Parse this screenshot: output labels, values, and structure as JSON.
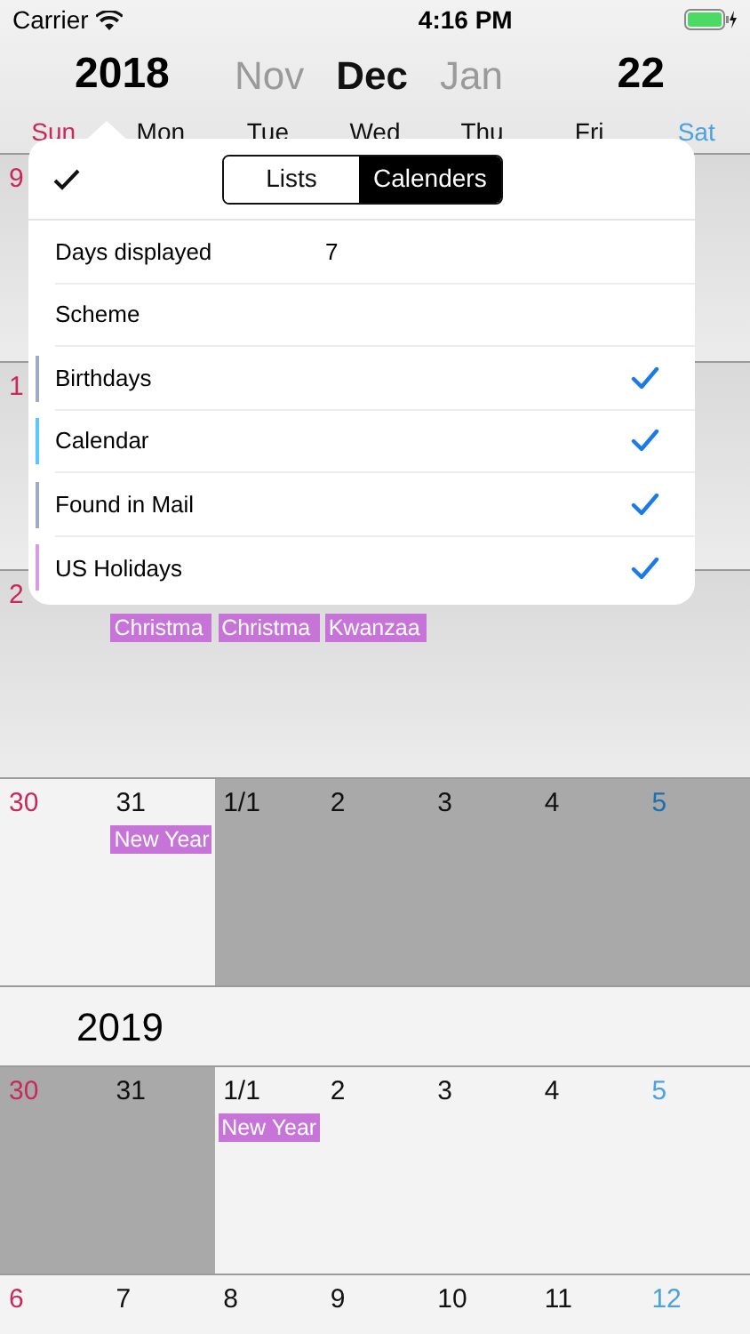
{
  "status_bar": {
    "carrier": "Carrier",
    "time": "4:16 PM"
  },
  "header": {
    "year": "2018",
    "months": [
      {
        "label": "Nov",
        "selected": false
      },
      {
        "label": "Dec",
        "selected": true
      },
      {
        "label": "Jan",
        "selected": false
      }
    ],
    "day": "22"
  },
  "weekdays": [
    {
      "label": "Sun",
      "kind": "sun"
    },
    {
      "label": "Mon",
      "kind": "day"
    },
    {
      "label": "Tue",
      "kind": "day"
    },
    {
      "label": "Wed",
      "kind": "day"
    },
    {
      "label": "Thu",
      "kind": "day"
    },
    {
      "label": "Fri",
      "kind": "day"
    },
    {
      "label": "Sat",
      "kind": "sat"
    }
  ],
  "blocks": [
    {
      "kind": "weeks",
      "weeks": [
        {
          "dimmed": true,
          "cells": [
            {
              "label": "9",
              "kind": "sun",
              "shaded": false
            }
          ]
        },
        {
          "dimmed": true,
          "cells": [
            {
              "label": "1",
              "kind": "sun",
              "shaded": false
            }
          ]
        },
        {
          "dimmed": true,
          "cells": [
            {
              "label": "2",
              "kind": "sun",
              "shaded": false
            },
            {
              "shaded": false,
              "events": [
                {
                  "title": "Christma",
                  "color": "#c774d9"
                }
              ]
            },
            {
              "shaded": false,
              "events": [
                {
                  "title": "Christma",
                  "color": "#c774d9"
                }
              ]
            },
            {
              "shaded": false,
              "events": [
                {
                  "title": "Kwanzaa",
                  "color": "#c774d9"
                }
              ]
            }
          ]
        },
        {
          "dimmed": false,
          "cells": [
            {
              "label": "30",
              "kind": "sun",
              "shaded": false
            },
            {
              "label": "31",
              "kind": "day",
              "shaded": false,
              "events": [
                {
                  "title": "New Year",
                  "color": "#c774d9"
                }
              ]
            },
            {
              "label": "1/1",
              "kind": "day",
              "shaded": true
            },
            {
              "label": "2",
              "kind": "day",
              "shaded": true
            },
            {
              "label": "3",
              "kind": "day",
              "shaded": true
            },
            {
              "label": "4",
              "kind": "day",
              "shaded": true
            },
            {
              "label": "5",
              "kind": "sat",
              "shaded": true
            }
          ]
        }
      ]
    },
    {
      "kind": "year",
      "label": "2019"
    },
    {
      "kind": "weeks",
      "weeks": [
        {
          "dimmed": false,
          "cells": [
            {
              "label": "30",
              "kind": "sun",
              "shaded": true
            },
            {
              "label": "31",
              "kind": "day",
              "shaded": true
            },
            {
              "label": "1/1",
              "kind": "day",
              "shaded": false,
              "events": [
                {
                  "title": "New Year",
                  "color": "#c774d9"
                }
              ]
            },
            {
              "label": "2",
              "kind": "day",
              "shaded": false
            },
            {
              "label": "3",
              "kind": "day",
              "shaded": false
            },
            {
              "label": "4",
              "kind": "day",
              "shaded": false
            },
            {
              "label": "5",
              "kind": "sat",
              "shaded": false
            }
          ]
        },
        {
          "dimmed": false,
          "cells": [
            {
              "label": "6",
              "kind": "sun",
              "shaded": false
            },
            {
              "label": "7",
              "kind": "day",
              "shaded": false
            },
            {
              "label": "8",
              "kind": "day",
              "shaded": false
            },
            {
              "label": "9",
              "kind": "day",
              "shaded": false
            },
            {
              "label": "10",
              "kind": "day",
              "shaded": false
            },
            {
              "label": "11",
              "kind": "day",
              "shaded": false
            },
            {
              "label": "12",
              "kind": "sat",
              "shaded": false
            }
          ]
        }
      ]
    }
  ],
  "popover": {
    "segments": [
      {
        "label": "Lists",
        "selected": false
      },
      {
        "label": "Calenders",
        "selected": true
      }
    ],
    "settings": [
      {
        "label": "Days displayed",
        "value": "7"
      },
      {
        "label": "Scheme"
      }
    ],
    "calendars": [
      {
        "name": "Birthdays",
        "color": "#a3abc4",
        "checked": true
      },
      {
        "name": "Calendar",
        "color": "#5ac8fa",
        "checked": true
      },
      {
        "name": "Found in Mail",
        "color": "#a3abc4",
        "checked": true
      },
      {
        "name": "US Holidays",
        "color": "#d99be3",
        "checked": true
      }
    ]
  }
}
